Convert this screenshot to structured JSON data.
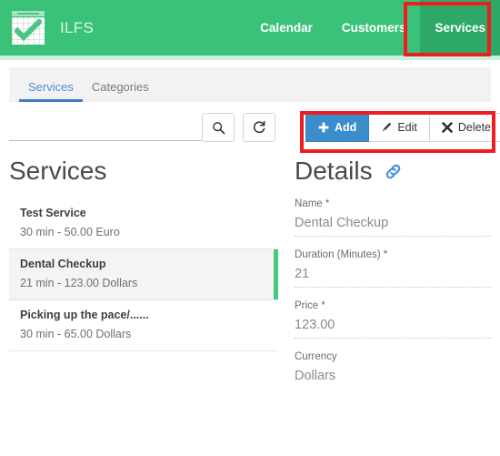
{
  "header": {
    "brand_name": "ILFS",
    "logo_icon": "calendar-check-icon",
    "nav": [
      {
        "label": "Calendar",
        "active": false
      },
      {
        "label": "Customers",
        "active": false
      },
      {
        "label": "Services",
        "active": true
      }
    ],
    "colors": {
      "bar": "#3ac279",
      "active_nav": "#2da866",
      "underline": "#c9f0db",
      "highlight": "#ef1c20"
    }
  },
  "tabs": [
    {
      "label": "Services",
      "active": true
    },
    {
      "label": "Categories",
      "active": false
    }
  ],
  "toolbar": {
    "search": {
      "value": "",
      "placeholder": ""
    },
    "search_icon": "search-icon",
    "refresh_icon": "refresh-icon",
    "buttons": [
      {
        "label": "Add",
        "icon": "plus-icon",
        "primary": true
      },
      {
        "label": "Edit",
        "icon": "pencil-icon",
        "primary": false
      },
      {
        "label": "Delete",
        "icon": "times-icon",
        "primary": false
      }
    ],
    "accent_color": "#3c8dcb"
  },
  "services_panel": {
    "title": "Services",
    "items": [
      {
        "name": "Test Service",
        "meta": "30 min - 50.00 Euro",
        "selected": false
      },
      {
        "name": "Dental Checkup",
        "meta": "21 min - 123.00 Dollars",
        "selected": true
      },
      {
        "name": "Picking up the pace/......",
        "meta": "30 min - 65.00 Dollars",
        "selected": false
      }
    ],
    "selected_accent": "#49c97d"
  },
  "details_panel": {
    "title": "Details",
    "link_icon": "chain-link-icon",
    "fields": [
      {
        "label": "Name *",
        "value": "Dental Checkup"
      },
      {
        "label": "Duration (Minutes) *",
        "value": "21"
      },
      {
        "label": "Price *",
        "value": "123.00"
      },
      {
        "label": "Currency",
        "value": "Dollars"
      }
    ]
  }
}
